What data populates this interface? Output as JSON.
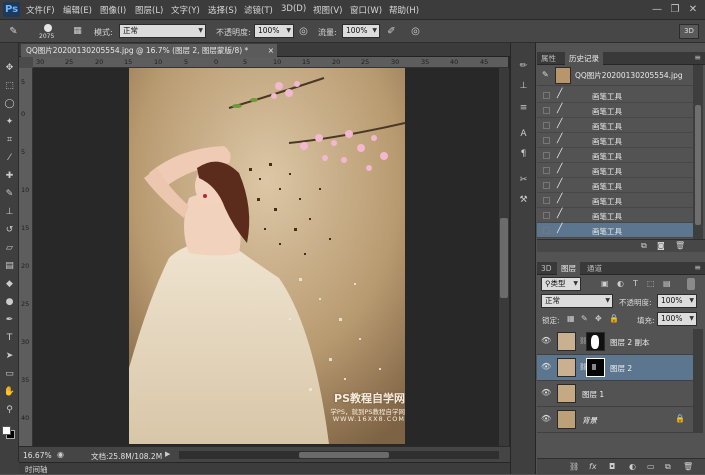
{
  "app": {
    "logo": "Ps"
  },
  "menu": [
    "文件(F)",
    "编辑(E)",
    "图像(I)",
    "图层(L)",
    "文字(Y)",
    "选择(S)",
    "滤镜(T)",
    "3D(D)",
    "视图(V)",
    "窗口(W)",
    "帮助(H)"
  ],
  "window_controls": {
    "minimize": "—",
    "restore": "❐",
    "close": "✕"
  },
  "options": {
    "brush_size": "2075",
    "mode_label": "模式:",
    "mode_value": "正常",
    "opacity_label": "不透明度:",
    "opacity_value": "100%",
    "flow_label": "流量:",
    "flow_value": "100%",
    "btn_3d": "3D"
  },
  "document": {
    "tab_title": "QQ图片20200130205554.jpg @ 16.7% (图层 2, 图层蒙版/8) *",
    "tab_close": "×",
    "ruler_h": [
      "30",
      "25",
      "20",
      "15",
      "10",
      "5",
      "0",
      "5",
      "10",
      "15",
      "20",
      "25",
      "30",
      "35",
      "40",
      "45"
    ],
    "ruler_v": [
      "5",
      "0",
      "5",
      "10",
      "15",
      "20",
      "25",
      "30",
      "35",
      "40"
    ],
    "zoom": "16.67%",
    "doc_info": "文档:25.8M/108.2M",
    "watermark_title": "PS教程自学网",
    "watermark_sub": "学PS，就到PS教程自学网",
    "watermark_url": "WWW.16XX8.COM"
  },
  "timeline": {
    "label": "时间轴"
  },
  "history": {
    "tabs": [
      "属性",
      "历史记录"
    ],
    "snapshot": "QQ图片20200130205554.jpg",
    "items": [
      "画笔工具",
      "画笔工具",
      "画笔工具",
      "画笔工具",
      "画笔工具",
      "画笔工具",
      "画笔工具",
      "画笔工具",
      "画笔工具",
      "画笔工具"
    ]
  },
  "layers": {
    "tabs": [
      "3D",
      "图层",
      "通道"
    ],
    "filter_kind": "类型",
    "blend_mode": "正常",
    "opacity_label": "不透明度:",
    "opacity_value": "100%",
    "lock_label": "锁定:",
    "fill_label": "填充:",
    "fill_value": "100%",
    "items": [
      {
        "name": "图层 2 副本"
      },
      {
        "name": "图层 2"
      },
      {
        "name": "图层 1"
      },
      {
        "name": "背景"
      }
    ],
    "bottom_icons": [
      "link-icon",
      "fx-icon",
      "mask-icon",
      "adjustment-icon",
      "group-icon",
      "new-layer-icon",
      "trash-icon"
    ]
  }
}
